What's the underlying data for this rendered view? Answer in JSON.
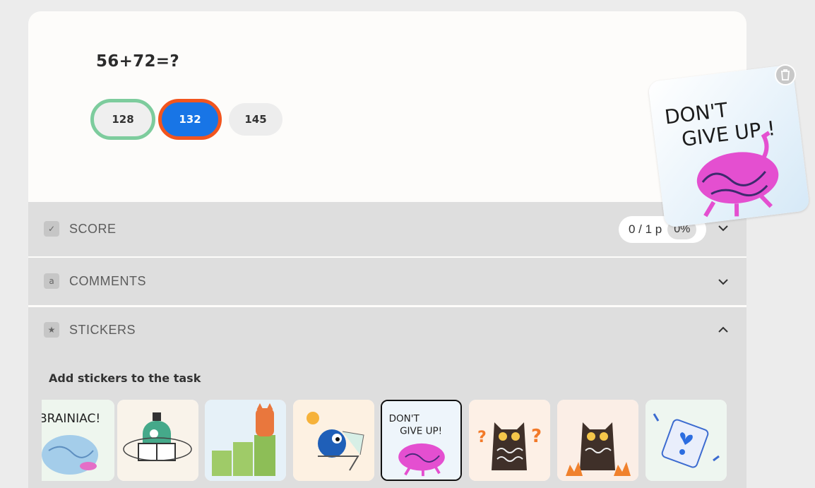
{
  "question": {
    "text": "56+72=?"
  },
  "answers": [
    {
      "label": "128",
      "state": "correct"
    },
    {
      "label": "132",
      "state": "selected-wrong"
    },
    {
      "label": "145",
      "state": "neutral"
    }
  ],
  "score": {
    "title": "SCORE",
    "points": "0 / 1 p",
    "percent": "0%",
    "icon": "score-icon"
  },
  "comments": {
    "title": "COMMENTS",
    "icon": "comment-icon"
  },
  "stickers": {
    "title": "STICKERS",
    "subtitle": "Add stickers to the task",
    "icon": "star-icon",
    "items": [
      {
        "name": "brainiac",
        "text": "BRAINIAC!"
      },
      {
        "name": "reading-robot",
        "text": ""
      },
      {
        "name": "cat-on-bars",
        "text": ""
      },
      {
        "name": "relaxing-blob",
        "text": ""
      },
      {
        "name": "dont-give-up",
        "text": "DON'T GIVE UP!",
        "selected": true
      },
      {
        "name": "confused-owl",
        "text": ""
      },
      {
        "name": "angry-owl",
        "text": ""
      },
      {
        "name": "happy-eraser",
        "text": ""
      }
    ]
  },
  "placed_sticker": {
    "line1": "DON'T",
    "line2": "GIVE UP !"
  },
  "colors": {
    "correct": "#7dcc9d",
    "wrong": "#f2551e",
    "selected_fill": "#1875e6",
    "panel": "#dedede"
  }
}
